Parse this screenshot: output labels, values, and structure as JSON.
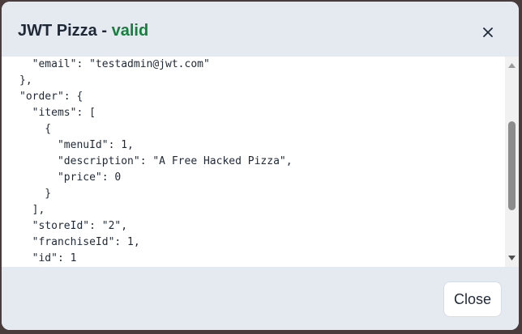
{
  "modal": {
    "title": "JWT Pizza - ",
    "status": "valid",
    "close_label": "Close"
  },
  "code_lines": [
    "  \"email\": \"testadmin@jwt.com\"",
    "},",
    "\"order\": {",
    "  \"items\": [",
    "    {",
    "      \"menuId\": 1,",
    "      \"description\": \"A Free Hacked Pizza\",",
    "      \"price\": 0",
    "    }",
    "  ],",
    "  \"storeId\": \"2\",",
    "  \"franchiseId\": 1,",
    "  \"id\": 1"
  ],
  "scrollbar": {
    "position_fraction": 0.55
  },
  "colors": {
    "status": "#15803d",
    "title": "#1f2937",
    "header_bg": "#e5eaf1"
  },
  "icons": {
    "dismiss": "close-x-icon",
    "scroll_up": "triangle-up-icon",
    "scroll_down": "triangle-down-icon"
  }
}
